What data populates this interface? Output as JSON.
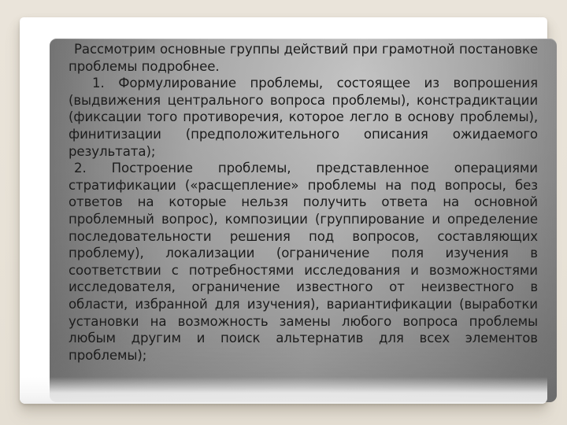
{
  "slide": {
    "background_color": "#e9e3d9",
    "card_color": "#ffffff",
    "panel_gradient_from": "#e7e7e7",
    "panel_gradient_to": "#9a9a9a",
    "text_color": "#1c1c1c",
    "paragraphs": [
      "Рассмотрим основные группы действий при грамотной постановке проблемы подробнее.",
      "1. Формулирование проблемы, состоящее из вопрошения (выдвижения центрального вопроса проблемы), констрадиктации (фиксации того противоречия, которое легло в основу проблемы), финитизации (предположительного описания ожидаемого результата);",
      "2. Построение проблемы, представленное операциями стратификации («расщепление» проблемы на под вопросы, без ответов на которые нельзя получить ответа на основной проблемный вопрос), композиции (группирование и определение последовательности решения под вопросов, составляющих проблему), локализации (ограничение поля изучения в соответствии с потребностями исследования и возможностями исследователя, ограничение известного от неизвестного в области, избранной для изучения), вариантификации (выработки установки на возможность замены любого вопроса проблемы любым другим и поиск альтернатив для всех элементов проблемы);"
    ]
  }
}
